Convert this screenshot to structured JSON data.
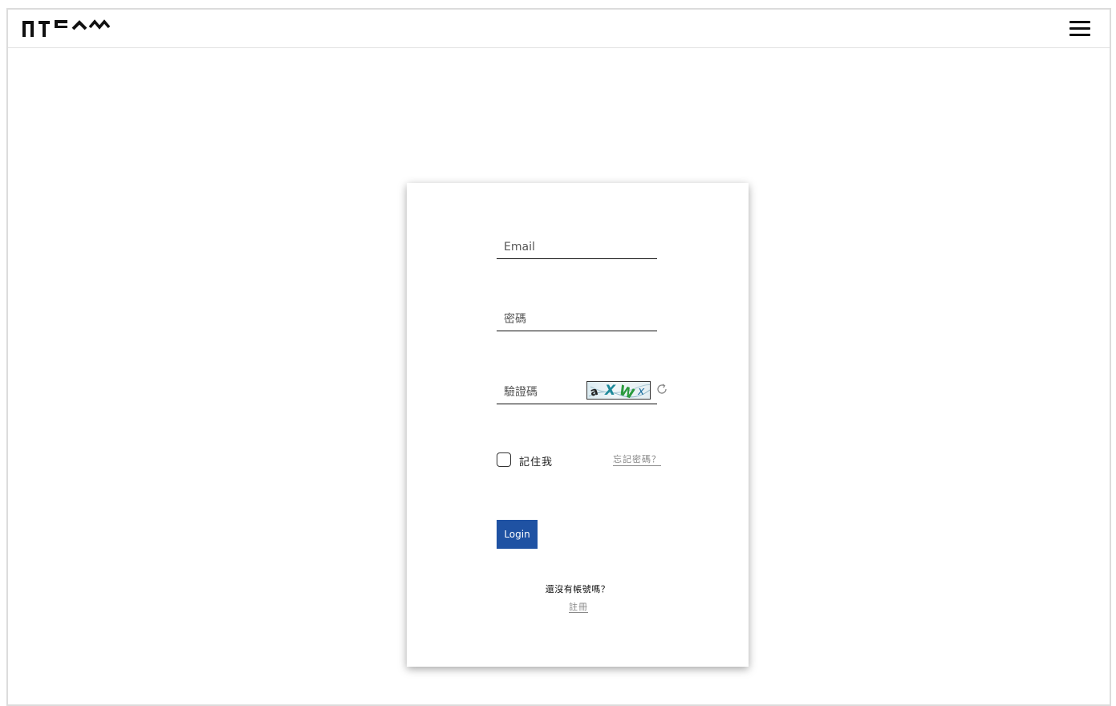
{
  "header": {
    "logo_text": "ПTEᴧᴍ",
    "menu_icon": "hamburger-menu-icon"
  },
  "login_form": {
    "email_placeholder": "Email",
    "password_placeholder": "密碼",
    "captcha_placeholder": "驗證碼",
    "captcha_text": "aXWx",
    "refresh_icon": "refresh-icon",
    "remember_label": "記住我",
    "forgot_password": "忘記密碼？",
    "login_label": "Login",
    "no_account_text": "還沒有帳號嗎？",
    "register_link": "註冊"
  },
  "colors": {
    "primary_button": "#1f52a3",
    "link_gray": "#888888"
  }
}
